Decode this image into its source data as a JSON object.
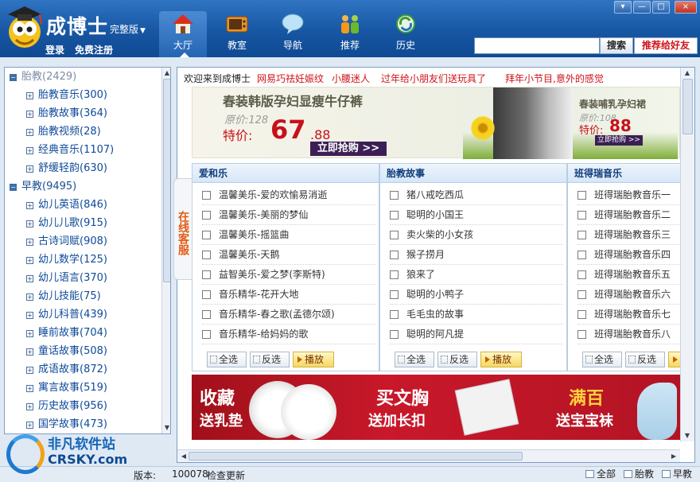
{
  "header": {
    "title": "成博士",
    "edition": "完整版",
    "login": "登录",
    "register": "免费注册",
    "nav": [
      {
        "label": "大厅",
        "icon": "house-icon"
      },
      {
        "label": "教室",
        "icon": "tv-icon"
      },
      {
        "label": "导航",
        "icon": "chat-bubble-icon"
      },
      {
        "label": "推荐",
        "icon": "people-icon"
      },
      {
        "label": "历史",
        "icon": "recycle-icon"
      }
    ],
    "search_value": "",
    "search_label": "搜索",
    "recommend_label": "推荐给好友",
    "window_controls": [
      "▾",
      "—",
      "□",
      "×"
    ]
  },
  "sidebar": {
    "categories": [
      {
        "label": "胎教(2429)",
        "top": 0,
        "items": [
          "胎教音乐(300)",
          "胎教故事(364)",
          "胎教视频(28)",
          "经典音乐(1107)",
          "舒缓轻韵(630)"
        ]
      },
      {
        "label": "早教(9495)",
        "items": [
          "幼儿英语(846)",
          "幼儿儿歌(915)",
          "古诗词赋(908)",
          "幼儿数学(125)",
          "幼儿语言(370)",
          "幼儿技能(75)",
          "幼儿科普(439)",
          "睡前故事(704)",
          "童话故事(508)",
          "成语故事(872)",
          "寓言故事(519)",
          "历史故事(956)",
          "国学故事(473)"
        ]
      }
    ]
  },
  "service_tab": "在线客服",
  "content": {
    "welcome": "欢迎来到成博士",
    "notices": [
      "网易巧祛妊娠纹",
      "小腰迷人",
      "过年给小朋友们送玩具了",
      "拜年小节目,意外的感觉"
    ],
    "banner1": {
      "title": "春装韩版孕妇显瘦牛仔裤",
      "orig_price": "原价:128",
      "price_label": "特价:",
      "price": "67",
      "price_cents": ".88",
      "buy": "立即抢购 >>",
      "title2": "春装哺乳孕妇裙",
      "orig_price2": "原价:108",
      "price_label2": "特价:",
      "price2": "88",
      "buy2": "立即抢购 >>"
    },
    "columns": [
      {
        "title": "爱和乐",
        "items": [
          "温馨美乐-爱的欢愉易消逝",
          "温馨美乐-美丽的梦仙",
          "温馨美乐-摇篮曲",
          "温馨美乐-天鹅",
          "益智美乐-爱之梦(李斯特)",
          "音乐精华-花开大地",
          "音乐精华-春之歌(孟德尔颂)",
          "音乐精华-给妈妈的歌"
        ]
      },
      {
        "title": "胎教故事",
        "items": [
          "猪八戒吃西瓜",
          "聪明的小国王",
          "卖火柴的小女孩",
          "猴子捞月",
          "狼来了",
          "聪明的小鸭子",
          "毛毛虫的故事",
          "聪明的阿凡提"
        ]
      },
      {
        "title": "班得瑞音乐",
        "items": [
          "班得瑞胎教音乐一",
          "班得瑞胎教音乐二",
          "班得瑞胎教音乐三",
          "班得瑞胎教音乐四",
          "班得瑞胎教音乐五",
          "班得瑞胎教音乐六",
          "班得瑞胎教音乐七",
          "班得瑞胎教音乐八"
        ]
      }
    ],
    "select_all": "全选",
    "invert": "反选",
    "play": "播放",
    "banner2": {
      "t1": "收藏",
      "s1": "送乳垫",
      "t2": "买文胸",
      "s2": "送加长扣",
      "t3": "满百",
      "s3": "送宝宝袜"
    }
  },
  "status": {
    "version_label": "版本:",
    "version_value": "100078",
    "update": "检查更新",
    "tabs": [
      "全部",
      "胎教",
      "早教"
    ]
  },
  "watermark": {
    "cn": "非凡软件站",
    "en": "CRSKY.com"
  },
  "colors": {
    "header": "#1756a3",
    "accent_red": "#d0131a",
    "link_blue": "#0e4a9a"
  }
}
